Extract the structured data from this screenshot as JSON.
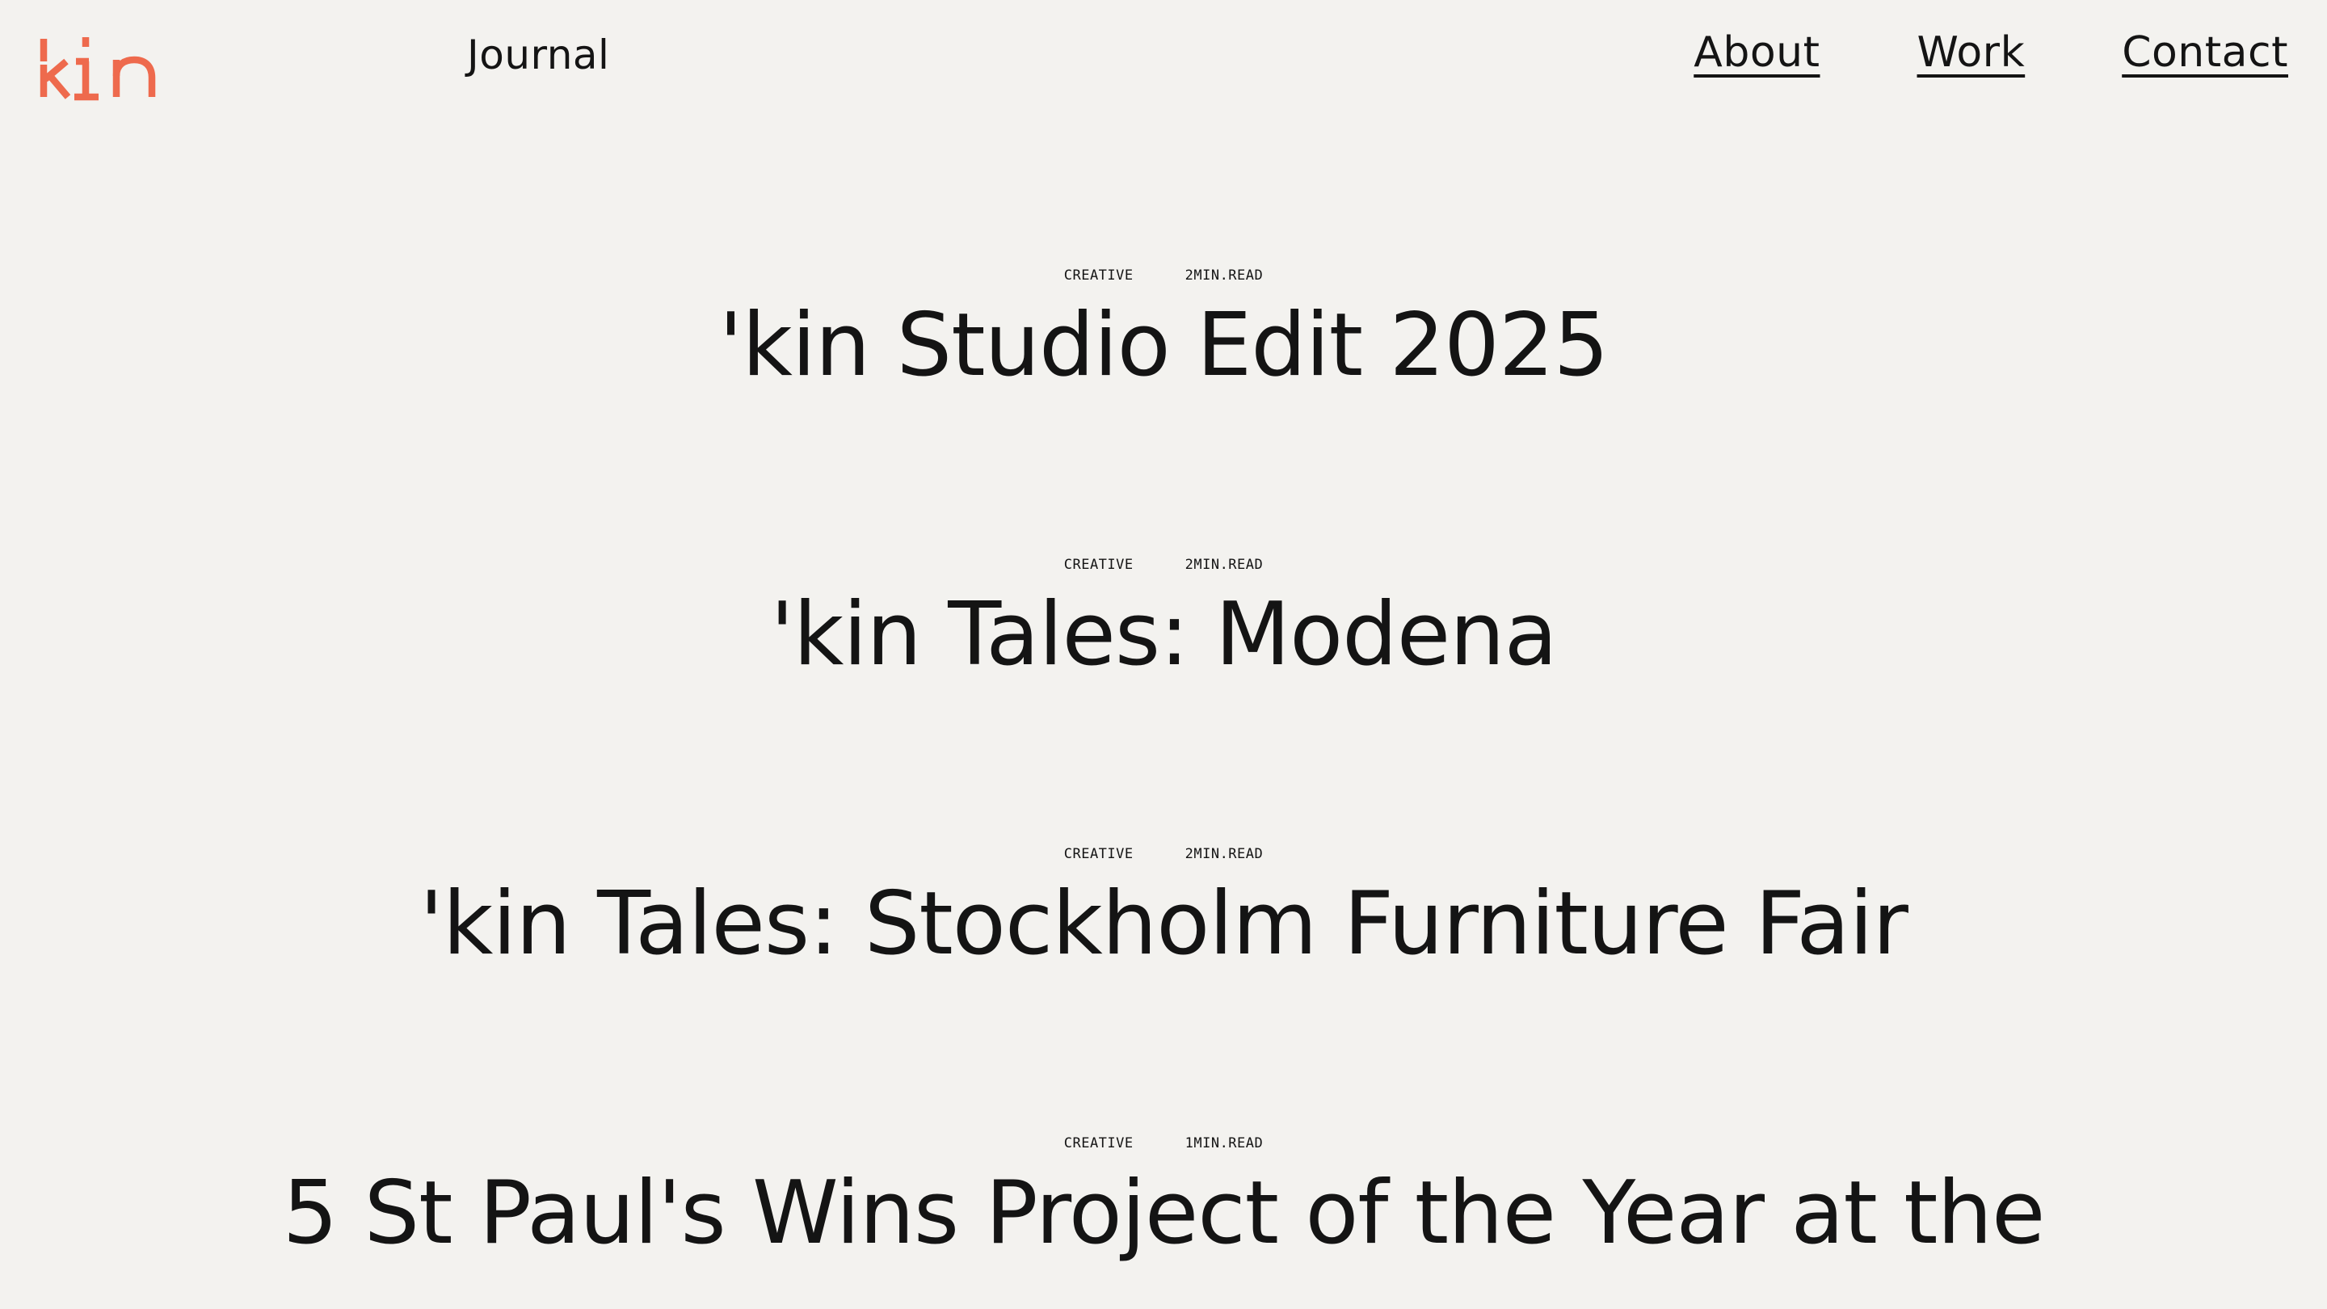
{
  "brand": {
    "logo_text": "'kin",
    "accent_color": "#ee6a4d"
  },
  "header": {
    "section_title": "Journal",
    "nav": [
      {
        "label": "About"
      },
      {
        "label": "Work"
      },
      {
        "label": "Contact"
      }
    ]
  },
  "articles": [
    {
      "category": "CREATIVE",
      "read_time": "2MIN.READ",
      "title": "'kin Studio Edit 2025"
    },
    {
      "category": "CREATIVE",
      "read_time": "2MIN.READ",
      "title": "'kin Tales: Modena"
    },
    {
      "category": "CREATIVE",
      "read_time": "2MIN.READ",
      "title": "'kin Tales: Stockholm Furniture Fair"
    },
    {
      "category": "CREATIVE",
      "read_time": "1MIN.READ",
      "title": "5 St Paul's Wins Project of the Year at the"
    }
  ]
}
